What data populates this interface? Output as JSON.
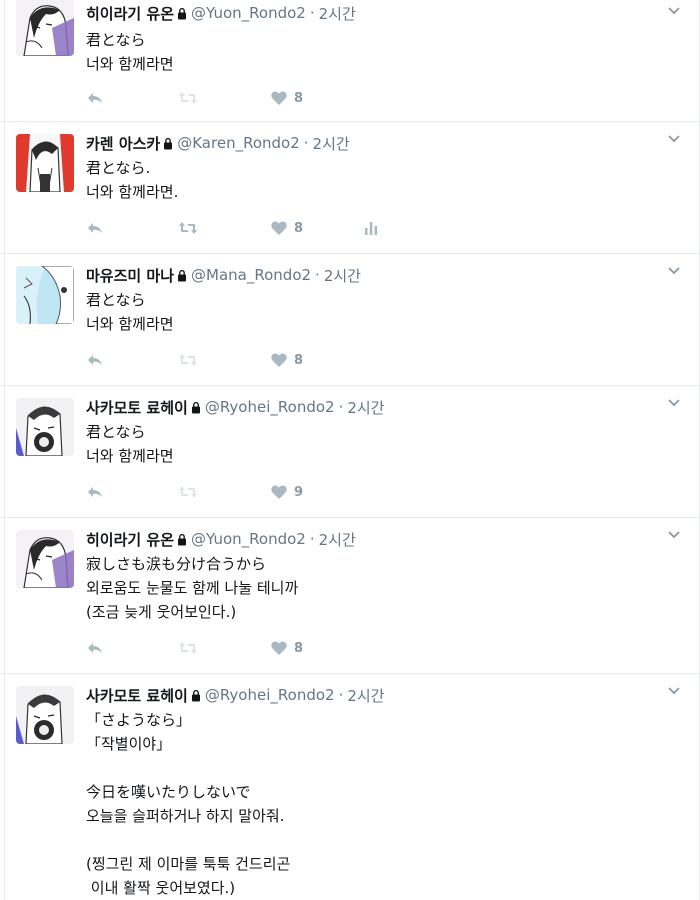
{
  "colors": {
    "text": "#14171a",
    "secondary": "#657786",
    "icon": "#aab8c2",
    "border": "#e6ecf0"
  },
  "tweets": [
    {
      "name": "히이라기 유온",
      "handle": "@Yuon_Rondo2",
      "separator": "·",
      "time": "2시간",
      "text": "君となら\n너와 함께라면",
      "likes": "8",
      "show_analytics": false,
      "avatar": "yuon"
    },
    {
      "name": "카렌 아스카",
      "handle": "@Karen_Rondo2",
      "separator": "·",
      "time": "2시간",
      "text": "君となら.\n너와 함께라면.",
      "likes": "8",
      "show_analytics": true,
      "avatar": "karen"
    },
    {
      "name": "마유즈미 마나",
      "handle": "@Mana_Rondo2",
      "separator": "·",
      "time": "2시간",
      "text": "君となら\n너와 함께라면",
      "likes": "8",
      "show_analytics": false,
      "avatar": "mana"
    },
    {
      "name": "사카모토 료헤이",
      "handle": "@Ryohei_Rondo2",
      "separator": "·",
      "time": "2시간",
      "text": "君となら\n너와 함께라면",
      "likes": "9",
      "show_analytics": false,
      "avatar": "ryohei"
    },
    {
      "name": "히이라기 유온",
      "handle": "@Yuon_Rondo2",
      "separator": "·",
      "time": "2시간",
      "text": "寂しさも涙も分け合うから\n외로움도 눈물도 함께 나눌 테니까\n(조금 늦게 웃어보인다.)",
      "likes": "8",
      "show_analytics": false,
      "avatar": "yuon"
    },
    {
      "name": "사카모토 료헤이",
      "handle": "@Ryohei_Rondo2",
      "separator": "·",
      "time": "2시간",
      "text": "「さようなら」\n「작별이야」\n\n今日を嘆いたりしないで\n오늘을 슬퍼하거나 하지 말아줘.\n\n(찡그린 제 이마를 툭툭 건드리곤\n 이내 활짝 웃어보였다.)",
      "likes": "",
      "show_analytics": false,
      "avatar": "ryohei"
    }
  ]
}
